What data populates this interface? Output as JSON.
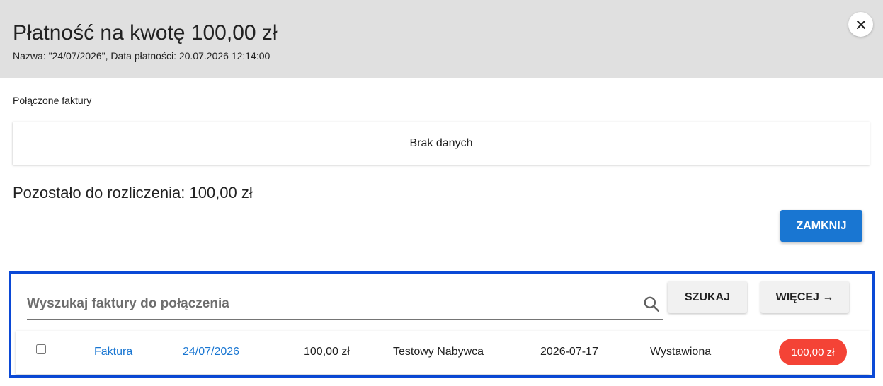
{
  "dialog": {
    "title": "Płatność na kwotę 100,00 zł",
    "subtitle": "Nazwa: \"24/07/2026\", Data płatności: 20.07.2026 12:14:00",
    "close_icon": "close-icon"
  },
  "linked_invoices": {
    "label": "Połączone faktury",
    "empty_text": "Brak danych"
  },
  "remaining": {
    "text": "Pozostało do rozliczenia: 100,00 zł"
  },
  "actions": {
    "close_label": "ZAMKNIJ"
  },
  "search": {
    "placeholder": "Wyszukaj faktury do połączenia",
    "value": "",
    "icon": "search-icon",
    "search_label": "SZUKAJ",
    "more_label": "WIĘCEJ →"
  },
  "results": [
    {
      "checked": false,
      "type": "Faktura",
      "number": "24/07/2026",
      "amount": "100,00 zł",
      "buyer": "Testowy Nabywca",
      "date": "2026-07-17",
      "status": "Wystawiona",
      "badge": "100,00 zł"
    }
  ],
  "colors": {
    "header_bg": "#e0e0e0",
    "primary": "#1976d2",
    "badge": "#f44336",
    "highlight_border": "#0b49d6"
  }
}
